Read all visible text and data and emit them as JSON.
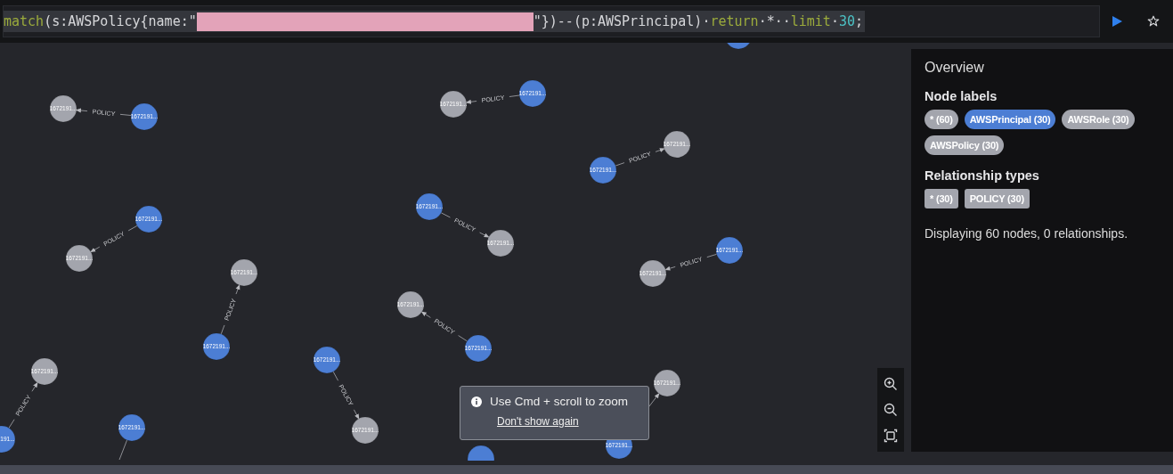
{
  "query_editor": {
    "tokens": [
      {
        "kind": "keyword",
        "text": "match"
      },
      {
        "kind": "plain",
        "text": "(s:AWSPolicy{name:\""
      },
      {
        "kind": "redaction"
      },
      {
        "kind": "plain",
        "text": "\"})--(p:AWSPrincipal)·"
      },
      {
        "kind": "keyword",
        "text": "return"
      },
      {
        "kind": "plain",
        "text": "·*··"
      },
      {
        "kind": "keyword",
        "text": "limit"
      },
      {
        "kind": "plain",
        "text": "·"
      },
      {
        "kind": "number",
        "text": "30"
      },
      {
        "kind": "plain",
        "text": ";"
      }
    ]
  },
  "graph": {
    "pairs": [
      {
        "source": {
          "label": "1672191...",
          "color": "#4c7ed4"
        },
        "target": {
          "label": "1672191...",
          "color": "#a3a5ad"
        },
        "relation": "POLICY"
      },
      {
        "source": {
          "label": "1672191...",
          "color": "#4c7ed4"
        },
        "target": {
          "label": "1672191...",
          "color": "#a3a5ad"
        },
        "relation": "POLICY"
      },
      {
        "source": {
          "label": "1672191...",
          "color": "#4c7ed4"
        },
        "target": {
          "label": "1672191...",
          "color": "#a3a5ad"
        },
        "relation": "POLICY"
      },
      {
        "source": {
          "label": "1672191...",
          "color": "#4c7ed4"
        },
        "target": {
          "label": "1672191...",
          "color": "#a3a5ad"
        },
        "relation": "POLICY"
      },
      {
        "source": {
          "label": "1672191...",
          "color": "#4c7ed4"
        },
        "target": {
          "label": "1672191...",
          "color": "#a3a5ad"
        },
        "relation": "POLICY"
      },
      {
        "source": {
          "label": "1672191...",
          "color": "#4c7ed4"
        },
        "target": {
          "label": "1672191...",
          "color": "#a3a5ad"
        },
        "relation": "POLICY"
      },
      {
        "source": {
          "label": "1672191...",
          "color": "#4c7ed4"
        },
        "target": {
          "label": "1672191...",
          "color": "#a3a5ad"
        },
        "relation": "POLICY"
      },
      {
        "source": {
          "label": "1672191...",
          "color": "#4c7ed4"
        },
        "target": {
          "label": "1672191...",
          "color": "#a3a5ad"
        },
        "relation": "POLICY"
      },
      {
        "source": {
          "label": "1672191...",
          "color": "#4c7ed4"
        },
        "target": {
          "label": "1672191...",
          "color": "#a3a5ad"
        },
        "relation": "POLICY"
      },
      {
        "source": {
          "label": "191...",
          "color": "#4c7ed4"
        },
        "target": {
          "label": "1672191...",
          "color": "#a3a5ad"
        },
        "relation": "POLICY"
      },
      {
        "source": {
          "label": "1672191...",
          "color": "#4c7ed4"
        },
        "target": {
          "label": "1672191...",
          "color": "#a3a5ad"
        }
      },
      {
        "source": {
          "label": "1672191...",
          "color": "#4c7ed4"
        }
      }
    ],
    "lone_nodes": [
      {
        "color": "#4c7ed4"
      },
      {
        "color": "#4c7ed4"
      }
    ]
  },
  "zoom_hint": {
    "message": "Use Cmd + scroll to zoom",
    "link": "Don't show again"
  },
  "overview": {
    "title": "Overview",
    "node_labels": {
      "heading": "Node labels",
      "chips": [
        {
          "label": "* (60)",
          "color": "#a3a5ad"
        },
        {
          "label": "AWSPrincipal (30)",
          "color": "#4c7ed4"
        },
        {
          "label": "AWSRole (30)",
          "color": "#a3a5ad"
        },
        {
          "label": "AWSPolicy (30)",
          "color": "#a3a5ad"
        }
      ]
    },
    "relationship_types": {
      "heading": "Relationship types",
      "chips": [
        {
          "label": "* (30)",
          "color": "#a3a5ad"
        },
        {
          "label": "POLICY (30)",
          "color": "#a3a5ad"
        }
      ]
    },
    "summary": "Displaying 60 nodes, 0 relationships."
  }
}
